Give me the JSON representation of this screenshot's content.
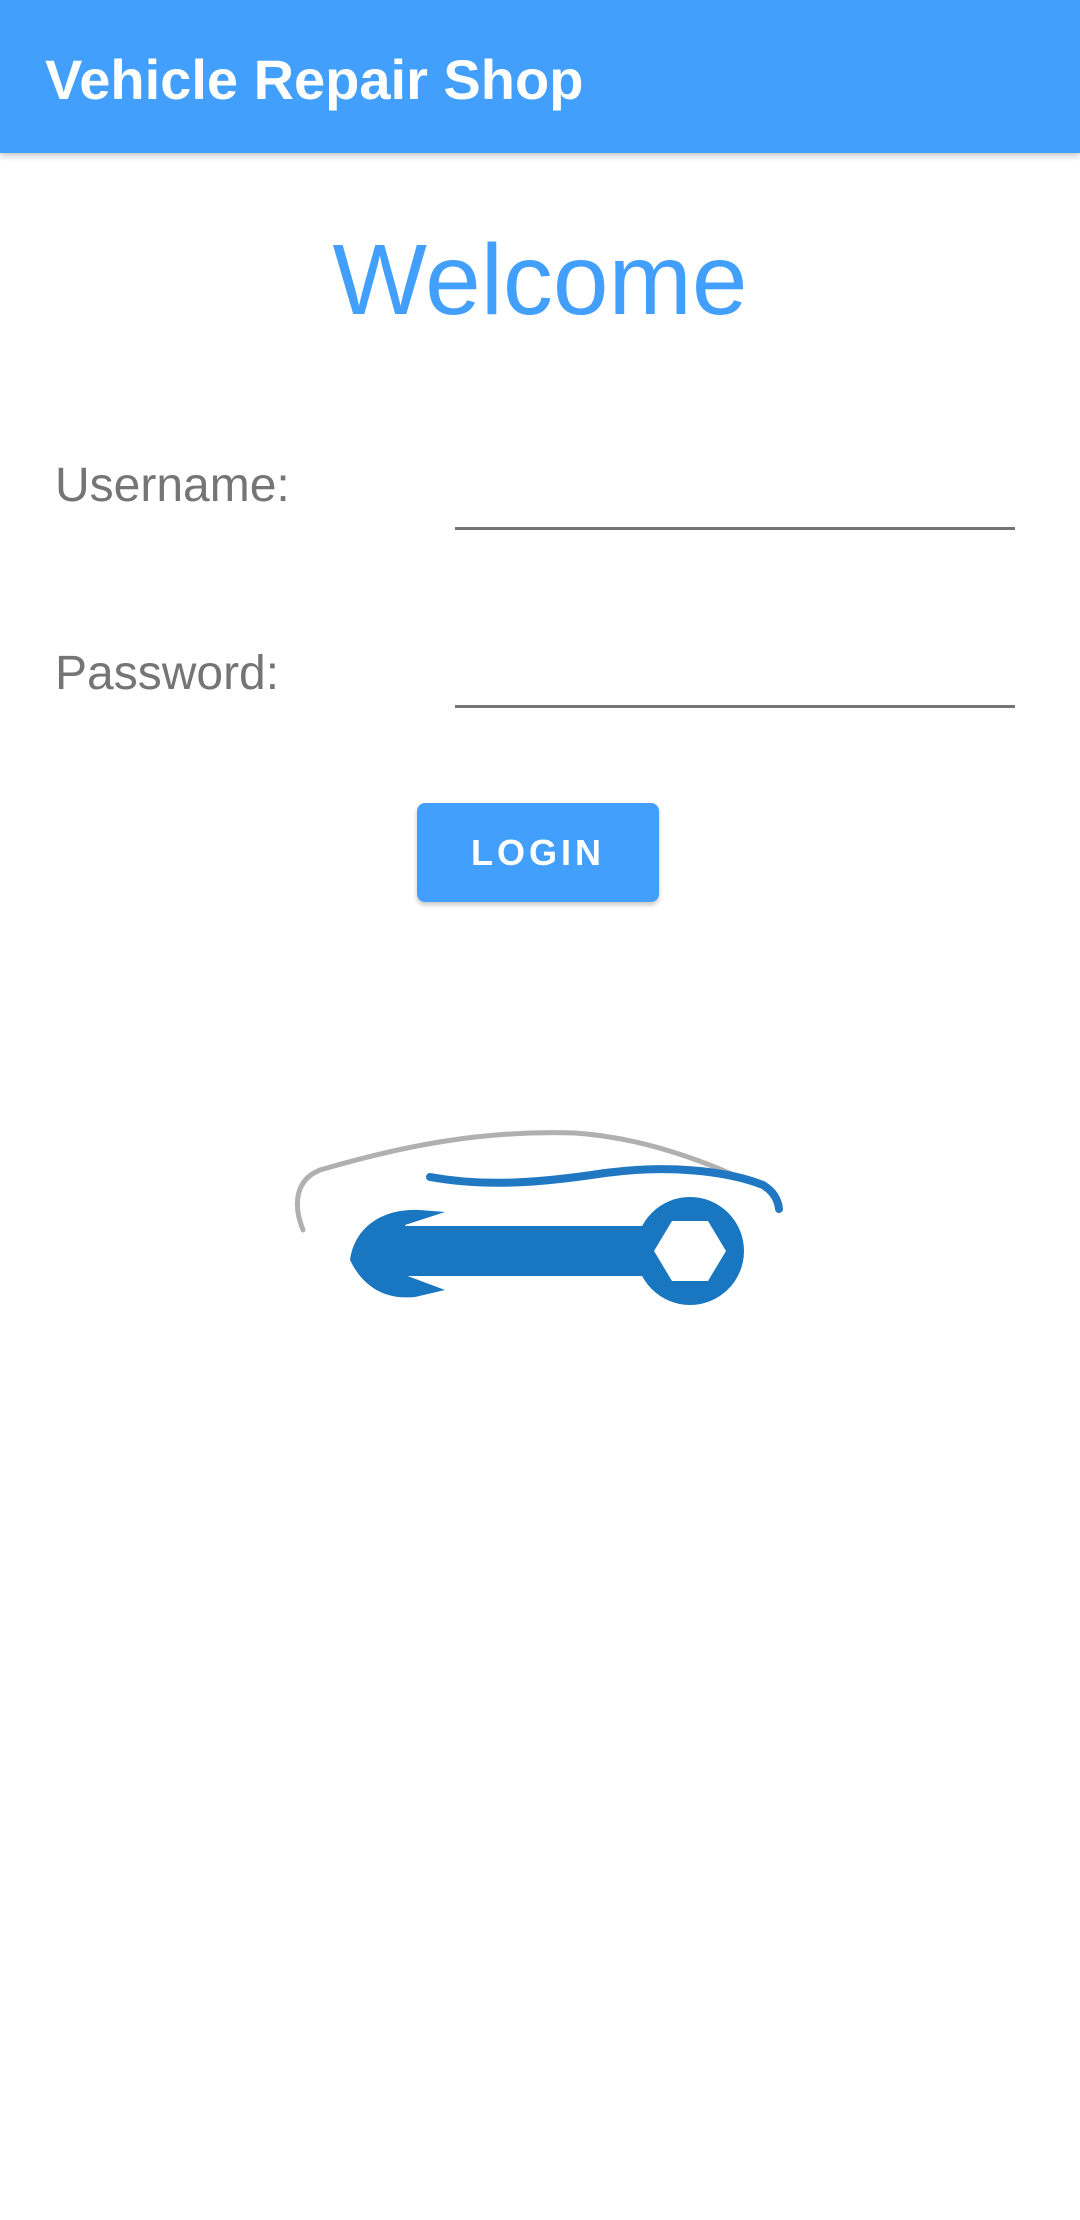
{
  "app_bar": {
    "title": "Vehicle Repair Shop",
    "background_color": "#42a0fc"
  },
  "welcome": {
    "heading": "Welcome",
    "color": "#42a0fc"
  },
  "form": {
    "username_label": "Username:",
    "username_value": "",
    "password_label": "Password:",
    "password_value": "",
    "login_button_label": "LOGIN"
  },
  "logo": {
    "icon": "car-wrench-logo-icon",
    "car_outline_color": "#b0b0b0",
    "car_accent_color": "#1f78c1",
    "wrench_color": "#1976c0"
  }
}
